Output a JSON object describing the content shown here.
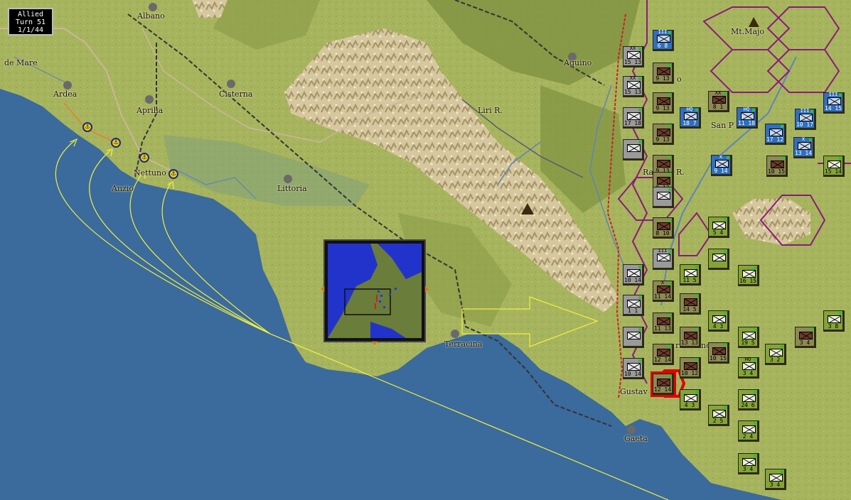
{
  "turn_box": {
    "side": "Allied",
    "turn": "Turn 51",
    "date": "1/1/44"
  },
  "places": {
    "albano": "Albano",
    "de_mare": "de Mare",
    "ardea": "Ardea",
    "aprilia": "Aprilia",
    "cisterna": "Cisterna",
    "anzio": "Anzio",
    "nettuno": "Nettuno",
    "littoria": "Littoria",
    "liri_r": "Liri R.",
    "aquino": "Aquino",
    "mt_majo": "Mt.Majo",
    "san_p": "San P",
    "ra_r": "Ra",
    "r_suffix": "R.",
    "terracina": "Terracina",
    "gustav": "Gustav",
    "gaeta": "Gaeta",
    "c_o": "o",
    "ri": "ri",
    "no": "no"
  },
  "units": [
    {
      "side": "allied",
      "size": "III",
      "values": "6 8"
    },
    {
      "side": "grey",
      "size": "XX",
      "values": "15 13"
    },
    {
      "side": "german",
      "size": "",
      "values": "9 13"
    },
    {
      "side": "grey",
      "size": "XX",
      "values": "15 13"
    },
    {
      "side": "german",
      "size": "",
      "values": "9 13"
    },
    {
      "side": "german",
      "size": "XX",
      "values": "8 1"
    },
    {
      "side": "allied",
      "size": "HQ",
      "values": "18 7"
    },
    {
      "side": "allied",
      "size": "HQ",
      "values": "11 18"
    },
    {
      "side": "grey",
      "size": "",
      "values": "17 18"
    },
    {
      "side": "german",
      "size": "",
      "values": "9 13"
    },
    {
      "side": "allied",
      "size": "",
      "values": "17 12"
    },
    {
      "side": "allied",
      "size": "III",
      "values": "10 17"
    },
    {
      "side": "allied",
      "size": "III",
      "values": "14 15"
    },
    {
      "side": "grey",
      "size": "",
      "values": ""
    },
    {
      "side": "german",
      "size": "",
      "values": "9 13"
    },
    {
      "side": "allied",
      "size": "X",
      "values": "13 14"
    },
    {
      "side": "german",
      "size": "",
      "values": "9 12"
    },
    {
      "side": "allied",
      "size": "X",
      "values": "9 14"
    },
    {
      "side": "german",
      "size": "",
      "values": "10 15"
    },
    {
      "side": "olive",
      "size": "",
      "values": "15 14"
    },
    {
      "side": "grey",
      "size": "",
      "values": ""
    },
    {
      "side": "olive",
      "size": "",
      "values": "5 4"
    },
    {
      "side": "german",
      "size": "",
      "values": "8 10"
    },
    {
      "side": "olive",
      "size": "",
      "values": ""
    },
    {
      "side": "grey",
      "size": "III",
      "values": ""
    },
    {
      "side": "olive",
      "size": "",
      "values": "11 5"
    },
    {
      "side": "olive",
      "size": "",
      "values": "16 15"
    },
    {
      "side": "grey",
      "size": "",
      "values": "10 14"
    },
    {
      "side": "german",
      "size": "X",
      "values": "11 14"
    },
    {
      "side": "grey",
      "size": "",
      "values": "1 1"
    },
    {
      "side": "german",
      "size": "",
      "values": "14 5"
    },
    {
      "side": "olive",
      "size": "",
      "values": "4 3"
    },
    {
      "side": "olive",
      "size": "",
      "values": "3 8"
    },
    {
      "side": "german",
      "size": "",
      "values": "11 13"
    },
    {
      "side": "grey",
      "size": "",
      "values": ""
    },
    {
      "side": "german",
      "size": "",
      "values": "13 13"
    },
    {
      "side": "olive",
      "size": "",
      "values": "19 5"
    },
    {
      "side": "german",
      "size": "",
      "values": "3 4"
    },
    {
      "side": "german",
      "size": "",
      "values": "12 14"
    },
    {
      "side": "german",
      "size": "",
      "values": "10 12"
    },
    {
      "side": "german",
      "size": "",
      "values": "10 15"
    },
    {
      "side": "olive",
      "size": "HQ",
      "values": "3 4"
    },
    {
      "side": "olive",
      "size": "",
      "values": "3 2"
    },
    {
      "side": "grey",
      "size": "",
      "values": "10 14"
    },
    {
      "side": "german",
      "size": "",
      "values": "12 14"
    },
    {
      "side": "olive",
      "size": "",
      "values": "4 3"
    },
    {
      "side": "olive",
      "size": "",
      "values": "24 6"
    },
    {
      "side": "olive",
      "size": "",
      "values": "2 5"
    },
    {
      "side": "olive",
      "size": "",
      "values": "2 4"
    },
    {
      "side": "olive",
      "size": "",
      "values": "3 4"
    },
    {
      "side": "olive",
      "size": "",
      "values": "3 4"
    }
  ],
  "colors": {
    "sea": "#3b6a9c",
    "land": "#a3b060",
    "mountain": "#d8c8a0",
    "hex_border": "#8a1a7a",
    "front_line": "#cc2222",
    "landing_arrows": "#f0f040",
    "selected_unit": "#e00000"
  }
}
